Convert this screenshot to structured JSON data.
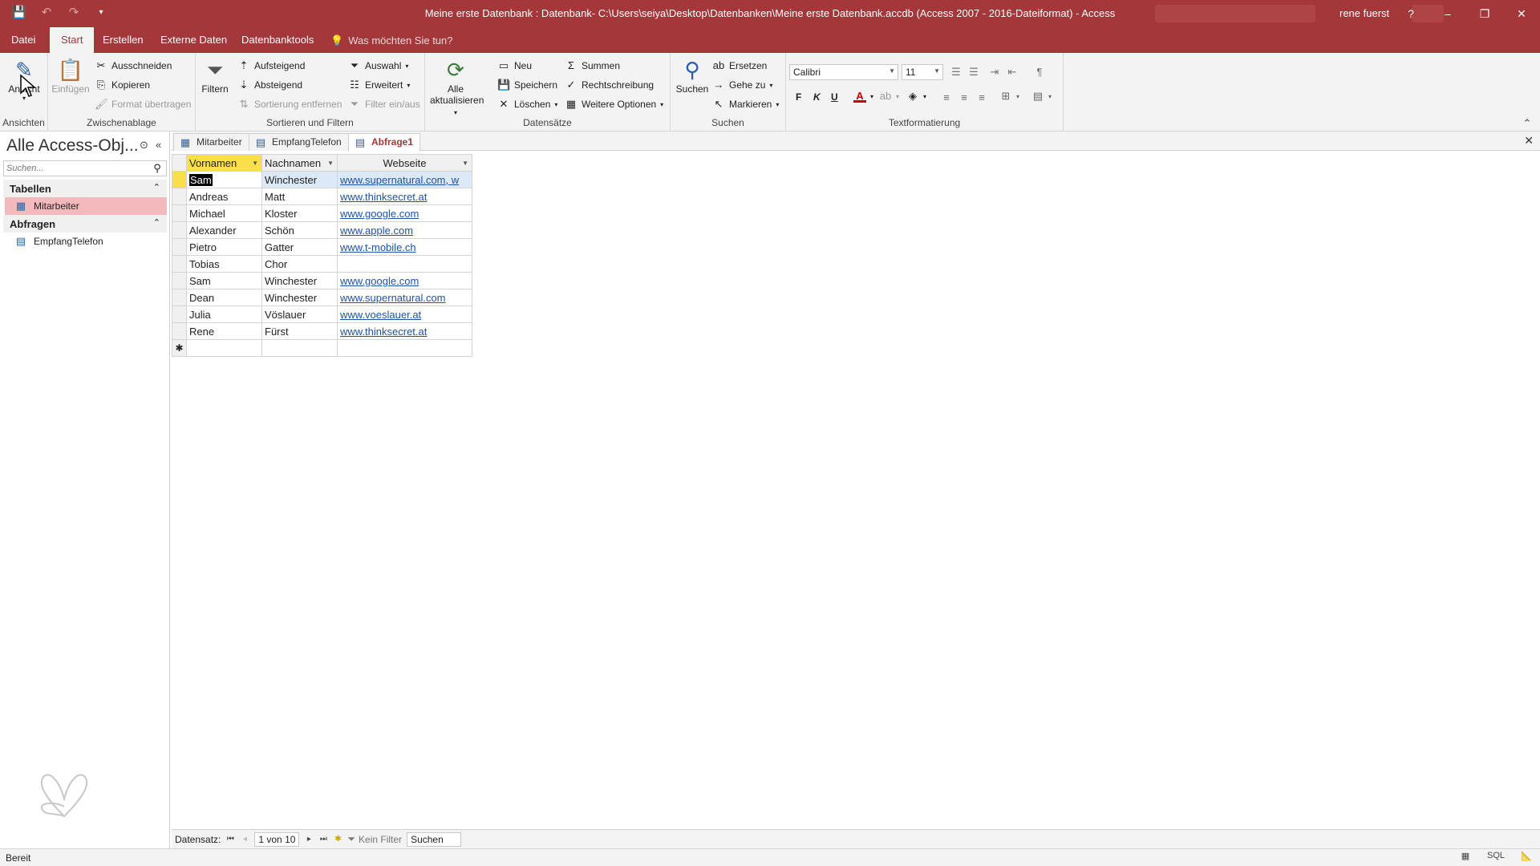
{
  "window": {
    "title": "Meine erste Datenbank : Datenbank- C:\\Users\\seiya\\Desktop\\Datenbanken\\Meine erste Datenbank.accdb (Access 2007 - 2016-Dateiformat)  -  Access",
    "user": "rene fuerst",
    "help": "?",
    "minimize": "–",
    "restore": "❐",
    "close": "✕"
  },
  "ribbon_tabs": [
    {
      "label": "Datei"
    },
    {
      "label": "Start"
    },
    {
      "label": "Erstellen"
    },
    {
      "label": "Externe Daten"
    },
    {
      "label": "Datenbanktools"
    }
  ],
  "tell_me": "Was möchten Sie tun?",
  "ribbon": {
    "ansichten": {
      "label": "Ansichten",
      "button": "Ansicht"
    },
    "zwischenablage": {
      "label": "Zwischenablage",
      "einfuegen": "Einfügen",
      "ausschneiden": "Ausschneiden",
      "kopieren": "Kopieren",
      "format": "Format übertragen"
    },
    "sortieren": {
      "label": "Sortieren und Filtern",
      "filtern": "Filtern",
      "aufsteigend": "Aufsteigend",
      "absteigend": "Absteigend",
      "sortierung_entfernen": "Sortierung entfernen",
      "auswahl": "Auswahl",
      "erweitert": "Erweitert",
      "filter_einaus": "Filter ein/aus"
    },
    "datensaetze": {
      "label": "Datensätze",
      "alle_aktualisieren_1": "Alle",
      "alle_aktualisieren_2": "aktualisieren",
      "neu": "Neu",
      "speichern": "Speichern",
      "loeschen": "Löschen",
      "summen": "Summen",
      "rechtschreibung": "Rechtschreibung",
      "weitere": "Weitere Optionen"
    },
    "suchen": {
      "label": "Suchen",
      "suchen": "Suchen",
      "ersetzen": "Ersetzen",
      "gehe_zu": "Gehe zu",
      "markieren": "Markieren"
    },
    "text": {
      "label": "Textformatierung",
      "font": "Calibri",
      "size": "11",
      "bold": "F",
      "italic": "K",
      "underline": "U"
    }
  },
  "nav": {
    "title": "Alle Access-Obj...",
    "search_placeholder": "Suchen...",
    "sections": [
      {
        "label": "Tabellen",
        "items": [
          "Mitarbeiter"
        ]
      },
      {
        "label": "Abfragen",
        "items": [
          "EmpfangTelefon"
        ]
      }
    ]
  },
  "doc_tabs": [
    {
      "label": "Mitarbeiter",
      "icon": "table-icon"
    },
    {
      "label": "EmpfangTelefon",
      "icon": "query-icon"
    },
    {
      "label": "Abfrage1",
      "icon": "query-icon"
    }
  ],
  "datasheet": {
    "columns": [
      "Vornamen",
      "Nachnamen",
      "Webseite"
    ],
    "rows": [
      [
        "Sam",
        "Winchester",
        "www.supernatural.com, w"
      ],
      [
        "Andreas",
        "Matt",
        "www.thinksecret.at"
      ],
      [
        "Michael",
        "Kloster",
        "www.google.com"
      ],
      [
        "Alexander",
        "Schön",
        "www.apple.com"
      ],
      [
        "Pietro",
        "Gatter",
        "www.t-mobile.ch"
      ],
      [
        "Tobias",
        "Chor",
        ""
      ],
      [
        "Sam",
        "Winchester",
        "www.google.com"
      ],
      [
        "Dean",
        "Winchester",
        "www.supernatural.com"
      ],
      [
        "Julia",
        "Vöslauer",
        "www.voeslauer.at"
      ],
      [
        "Rene",
        "Fürst",
        "www.thinksecret.at"
      ]
    ],
    "new_row_marker": "✱"
  },
  "record_nav": {
    "label": "Datensatz:",
    "position": "1 von 10",
    "filter": "Kein Filter",
    "search": "Suchen"
  },
  "status": {
    "text": "Bereit",
    "sql": "SQL"
  },
  "colors": {
    "accent": "#a4373a",
    "header_highlight": "#f9e04b",
    "link": "#1f53a8"
  }
}
